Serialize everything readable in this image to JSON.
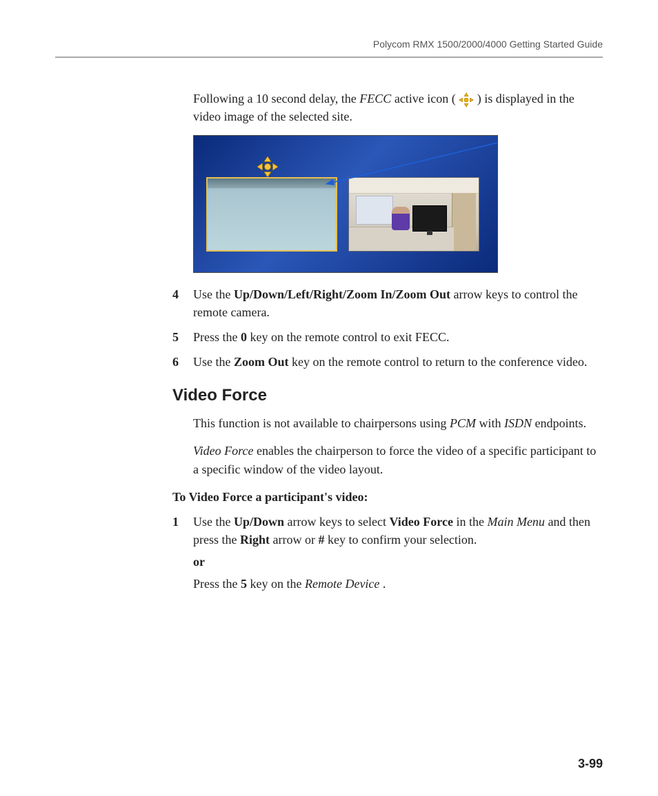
{
  "header": {
    "title": "Polycom RMX 1500/2000/4000 Getting Started Guide"
  },
  "intro": {
    "p1a": "Following a 10 second delay, the ",
    "fecc": "FECC",
    "p1b": " active icon ( ",
    "p1c": " ) is displayed in the video image of the selected site."
  },
  "icons": {
    "fecc": "fecc-active-icon"
  },
  "steps_a": [
    {
      "n": "4",
      "pre": "Use the ",
      "bold": "Up/Down/Left/Right/Zoom In/Zoom Out",
      "post": " arrow keys to control the remote camera."
    },
    {
      "n": "5",
      "pre": "Press the ",
      "bold": "0",
      "post": " key on the remote control to exit FECC."
    },
    {
      "n": "6",
      "pre": "Use the ",
      "bold": "Zoom Out",
      "post": " key on the remote control to return to the conference video."
    }
  ],
  "section": {
    "title": "Video Force"
  },
  "vf": {
    "p1a": "This function is not available to chairpersons using ",
    "p1b": "PCM",
    "p1c": " with ",
    "p1d": "ISDN",
    "p1e": " endpoints.",
    "p2a": "Video Force",
    "p2b": " enables the chairperson to force the video of a specific participant to a specific window of the video layout."
  },
  "lead": "To Video Force a participant's video:",
  "step1": {
    "n": "1",
    "a": "Use the ",
    "b": "Up/Down",
    "c": " arrow keys to select ",
    "d": "Video Force",
    "e": " in the ",
    "f": "Main Menu",
    "g": " and then press the ",
    "h": "Right",
    "i": " arrow or ",
    "j": "#",
    "k": " key to confirm your selection.",
    "or": "or",
    "l": "Press the ",
    "m": "5",
    "n2": " key on the ",
    "o": "Remote Device",
    "p": "."
  },
  "page_number": "3-99"
}
